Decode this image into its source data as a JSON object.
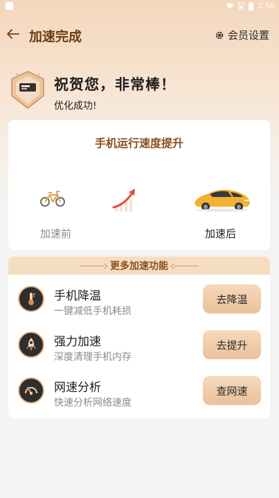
{
  "status_bar": {
    "time": "2:50"
  },
  "header": {
    "title": "加速完成",
    "settings_label": "会员设置"
  },
  "congrats": {
    "title": "祝贺您，非常棒！",
    "subtitle": "优化成功!"
  },
  "speed_card": {
    "title": "手机运行速度提升",
    "before_label": "加速前",
    "after_label": "加速后"
  },
  "more": {
    "title": "更多加速功能",
    "items": [
      {
        "title": "手机降温",
        "desc": "一键减低手机耗损",
        "button": "去降温",
        "icon": "thermometer-icon"
      },
      {
        "title": "强力加速",
        "desc": "深度清理手机内存",
        "button": "去提升",
        "icon": "rocket-icon"
      },
      {
        "title": "网速分析",
        "desc": "快速分析网络速度",
        "button": "查网速",
        "icon": "speedometer-icon"
      }
    ]
  },
  "colors": {
    "accent_brown": "#8a4f1c",
    "button_gold": "#e9c19a",
    "header_gradient": "#f3d7bc"
  }
}
